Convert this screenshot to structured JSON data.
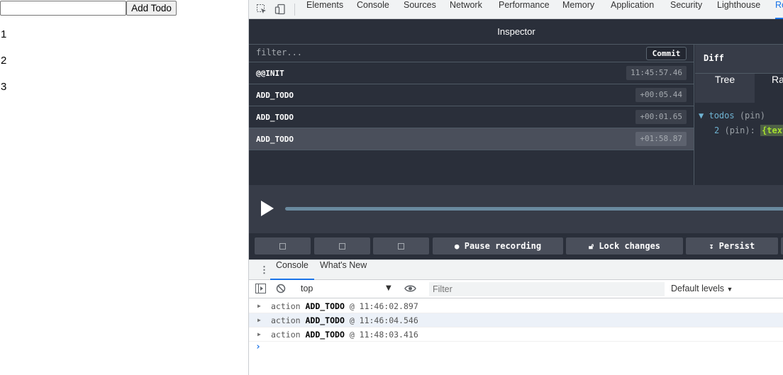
{
  "page": {
    "input_value": "",
    "add_button": "Add Todo",
    "todos": [
      "1",
      "2",
      "3"
    ]
  },
  "devtools": {
    "tabs": [
      "Elements",
      "Console",
      "Sources",
      "Network",
      "Performance",
      "Memory",
      "Application",
      "Security",
      "Lighthouse",
      "Re"
    ],
    "redux": {
      "title": "Inspector",
      "filter_placeholder": "filter...",
      "commit_label": "Commit",
      "actions": [
        {
          "name": "@@INIT",
          "time": "11:45:57.46"
        },
        {
          "name": "ADD_TODO",
          "time": "+00:05.44"
        },
        {
          "name": "ADD_TODO",
          "time": "+00:01.65"
        },
        {
          "name": "ADD_TODO",
          "time": "+01:58.87"
        }
      ],
      "diff": {
        "label": "Diff",
        "tabs": [
          "Tree",
          "Ra"
        ],
        "root_key": "todos",
        "root_suffix": "(pin)",
        "child_key": "2",
        "child_suffix": "(pin):",
        "child_value": "{text:"
      },
      "buttons": {
        "pause": "Pause recording",
        "lock": "Lock changes",
        "persist": "Persist"
      }
    },
    "drawer": {
      "tabs": [
        "Console",
        "What's New"
      ],
      "context": "top",
      "filter_placeholder": "Filter",
      "levels": "Default levels",
      "logs": [
        {
          "type": "action",
          "name": "ADD_TODO",
          "at": "@ 11:46:02.897"
        },
        {
          "type": "action",
          "name": "ADD_TODO",
          "at": "@ 11:46:04.546"
        },
        {
          "type": "action",
          "name": "ADD_TODO",
          "at": "@ 11:48:03.416"
        }
      ],
      "prompt": "›"
    }
  }
}
